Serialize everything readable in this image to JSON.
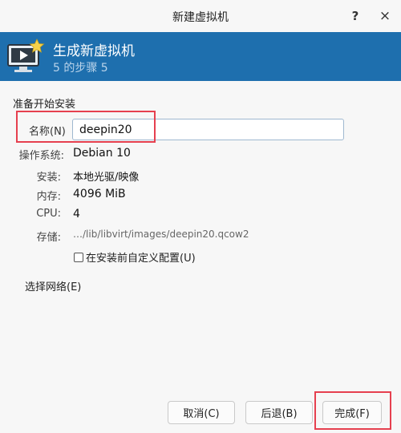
{
  "window": {
    "title": "新建虚拟机",
    "help_glyph": "?",
    "close_glyph": "×"
  },
  "banner": {
    "title": "生成新虚拟机",
    "step": "5 的步骤 5",
    "icon": "vm-screen-star-icon",
    "bg_color": "#1e6fae"
  },
  "section_title": "准备开始安装",
  "name": {
    "label": "名称(N)",
    "value": "deepin20"
  },
  "details": {
    "os_label": "操作系统:",
    "os_value": "Debian 10",
    "install_label": "安装:",
    "install_value": "本地光驱/映像",
    "memory_label": "内存:",
    "memory_value": "4096 MiB",
    "cpu_label": "CPU:",
    "cpu_value": "4",
    "storage_label": "存储:",
    "storage_value": "…/lib/libvirt/images/deepin20.qcow2"
  },
  "customize_checkbox": {
    "label": "在安装前自定义配置(U)",
    "checked": false
  },
  "network_expander": "选择网络(E)",
  "buttons": {
    "cancel": "取消(C)",
    "back": "后退(B)",
    "finish": "完成(F)"
  },
  "highlight_color": "#e6404f"
}
